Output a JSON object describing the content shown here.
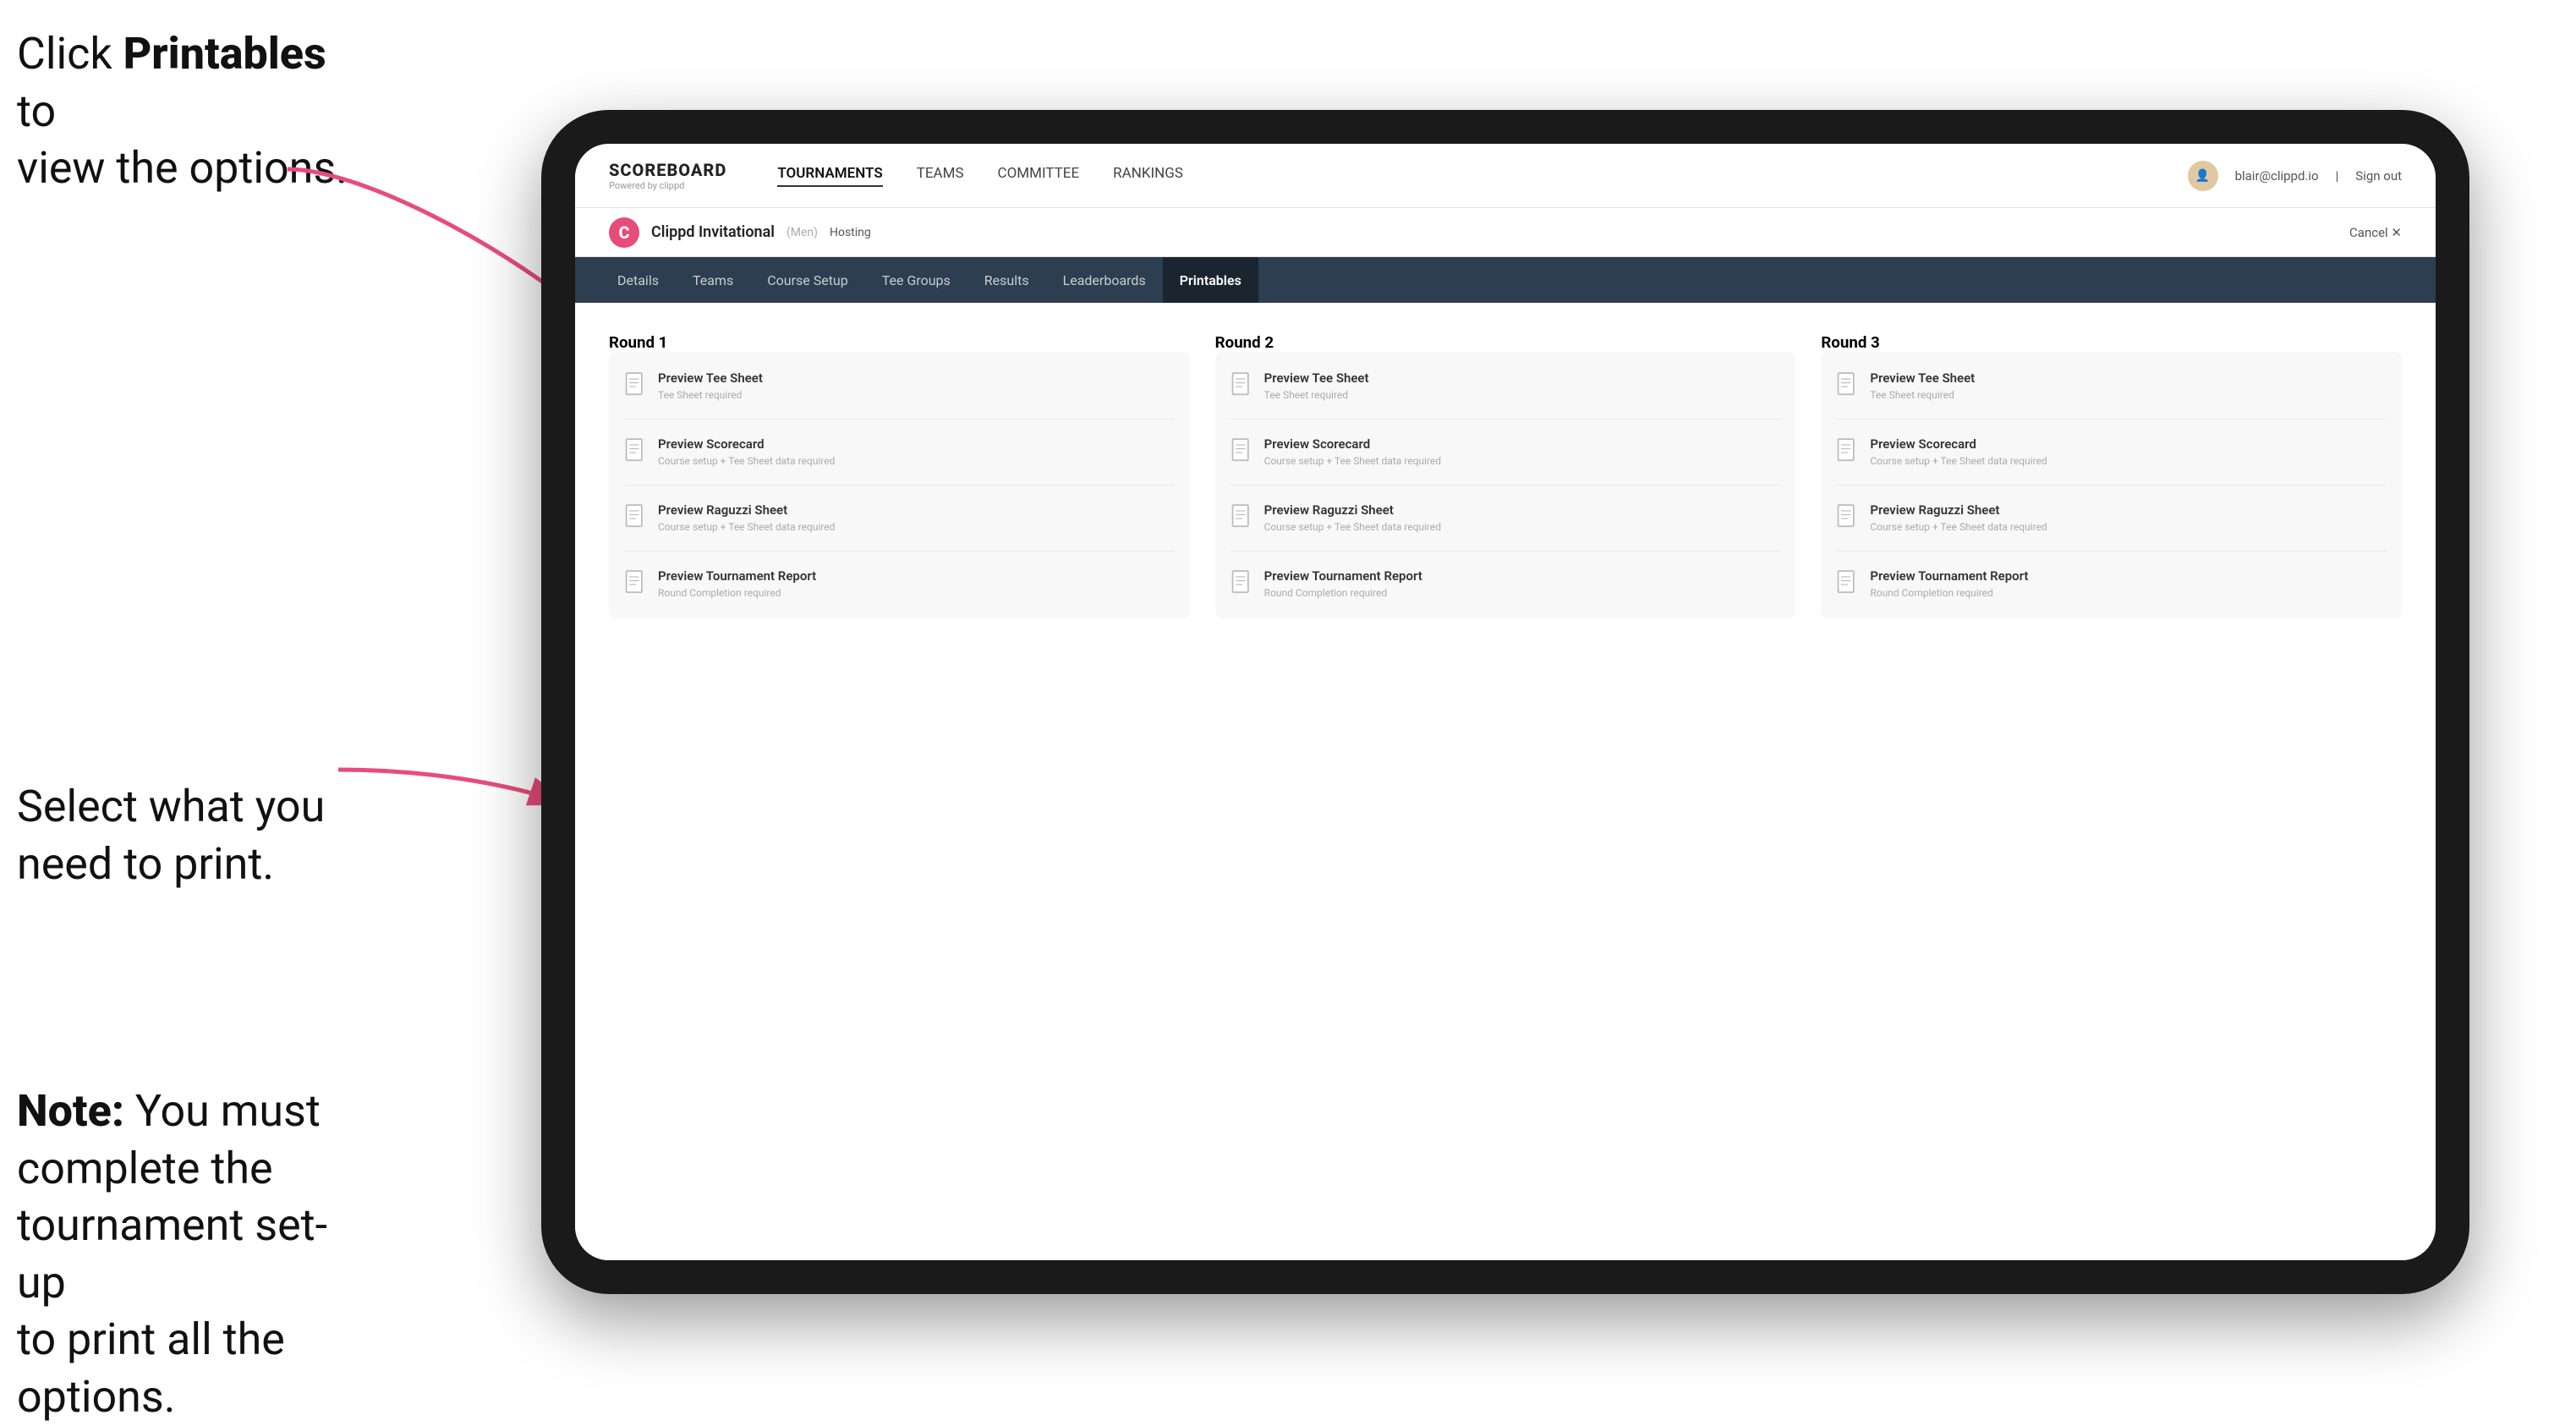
{
  "instructions": {
    "top_line1": "Click ",
    "top_bold": "Printables",
    "top_line2": " to",
    "top_line3": "view the options.",
    "mid_line1": "Select what you",
    "mid_line2": "need to print.",
    "note_bold": "Note:",
    "note_text": " You must complete the tournament set-up to print all the options."
  },
  "top_nav": {
    "brand_title": "SCOREBOARD",
    "brand_sub": "Powered by clippd",
    "links": [
      "TOURNAMENTS",
      "TEAMS",
      "COMMITTEE",
      "RANKINGS"
    ],
    "active_link": "TOURNAMENTS",
    "user_email": "blair@clippd.io",
    "sign_out": "Sign out"
  },
  "tournament_bar": {
    "logo_letter": "C",
    "name": "Clippd Invitational",
    "bracket": "(Men)",
    "status": "Hosting",
    "cancel": "Cancel ✕"
  },
  "sub_nav": {
    "tabs": [
      "Details",
      "Teams",
      "Course Setup",
      "Tee Groups",
      "Results",
      "Leaderboards",
      "Printables"
    ],
    "active_tab": "Printables"
  },
  "rounds": [
    {
      "label": "Round 1",
      "items": [
        {
          "title": "Preview Tee Sheet",
          "subtitle": "Tee Sheet required"
        },
        {
          "title": "Preview Scorecard",
          "subtitle": "Course setup + Tee Sheet data required"
        },
        {
          "title": "Preview Raguzzi Sheet",
          "subtitle": "Course setup + Tee Sheet data required"
        },
        {
          "title": "Preview Tournament Report",
          "subtitle": "Round Completion required"
        }
      ]
    },
    {
      "label": "Round 2",
      "items": [
        {
          "title": "Preview Tee Sheet",
          "subtitle": "Tee Sheet required"
        },
        {
          "title": "Preview Scorecard",
          "subtitle": "Course setup + Tee Sheet data required"
        },
        {
          "title": "Preview Raguzzi Sheet",
          "subtitle": "Course setup + Tee Sheet data required"
        },
        {
          "title": "Preview Tournament Report",
          "subtitle": "Round Completion required"
        }
      ]
    },
    {
      "label": "Round 3",
      "items": [
        {
          "title": "Preview Tee Sheet",
          "subtitle": "Tee Sheet required"
        },
        {
          "title": "Preview Scorecard",
          "subtitle": "Course setup + Tee Sheet data required"
        },
        {
          "title": "Preview Raguzzi Sheet",
          "subtitle": "Course setup + Tee Sheet data required"
        },
        {
          "title": "Preview Tournament Report",
          "subtitle": "Round Completion required"
        }
      ]
    }
  ]
}
